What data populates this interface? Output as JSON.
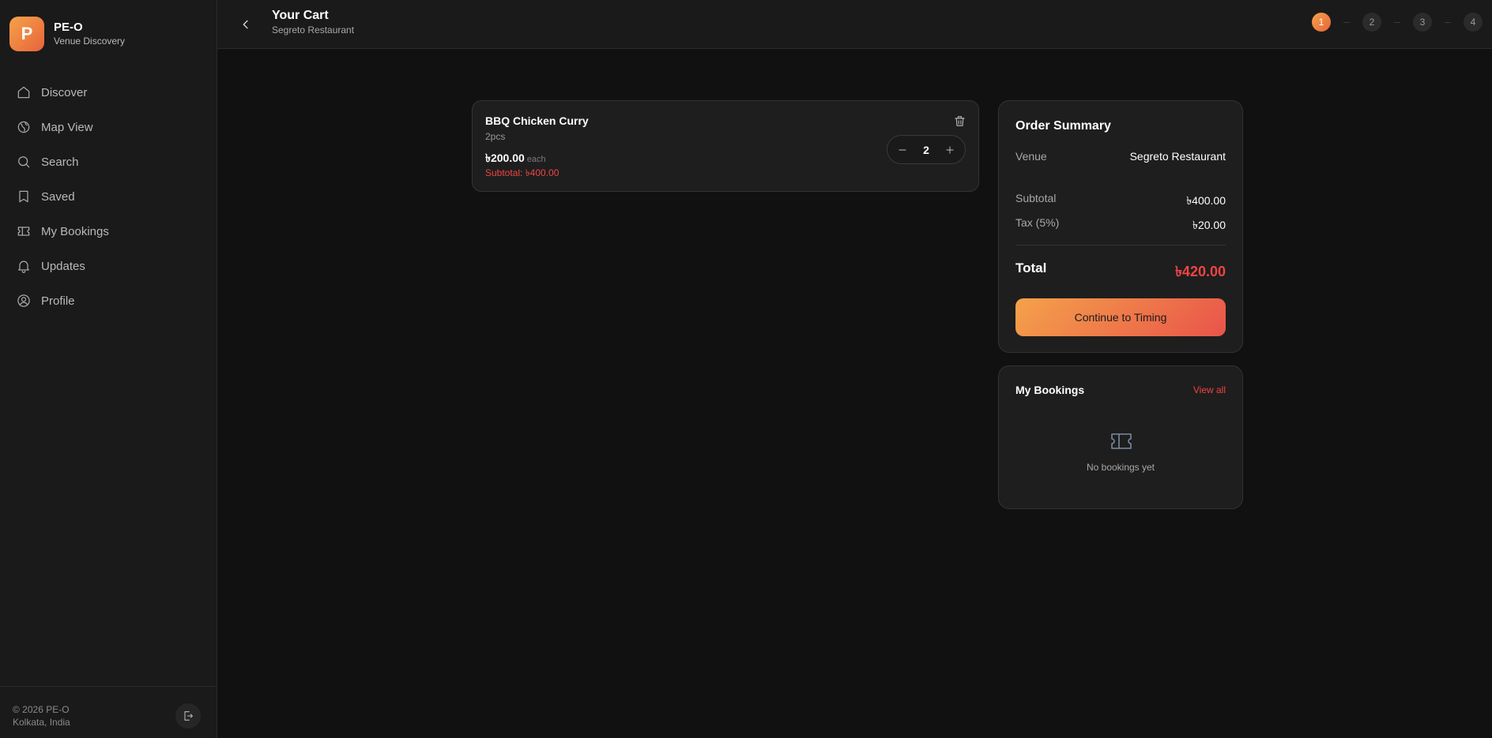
{
  "brand": {
    "logo_letter": "P",
    "name": "PE-O",
    "subtitle": "Venue Discovery",
    "accent": "#f07f3e"
  },
  "sidebar": {
    "items": [
      {
        "label": "Discover",
        "icon": "home-icon"
      },
      {
        "label": "Map View",
        "icon": "map-icon"
      },
      {
        "label": "Search",
        "icon": "search-icon"
      },
      {
        "label": "Saved",
        "icon": "bookmark-icon"
      },
      {
        "label": "My Bookings",
        "icon": "ticket-icon"
      },
      {
        "label": "Updates",
        "icon": "bell-icon"
      },
      {
        "label": "Profile",
        "icon": "user-icon"
      }
    ],
    "footer_line1": "© 2026 PE-O",
    "footer_line2": "Kolkata, India"
  },
  "header": {
    "title": "Your Cart",
    "subtitle": "Segreto Restaurant",
    "steps": [
      "1",
      "2",
      "3",
      "4"
    ],
    "active_step": 1
  },
  "cart": {
    "items": [
      {
        "name": "BBQ Chicken Curry",
        "variant": "2pcs",
        "price": "৳200.00",
        "each_label": "each",
        "subtotal": "Subtotal: ৳400.00",
        "quantity": "2"
      }
    ]
  },
  "summary": {
    "title": "Order Summary",
    "venue_label": "Venue",
    "venue_value": "Segreto Restaurant",
    "subtotal_label": "Subtotal",
    "subtotal_value": "৳400.00",
    "tax_label": "Tax (5%)",
    "tax_value": "৳20.00",
    "total_label": "Total",
    "total_value": "৳420.00",
    "continue_label": "Continue to Timing"
  },
  "bookings": {
    "title": "My Bookings",
    "view_all": "View all",
    "empty_text": "No bookings yet"
  },
  "colors": {
    "background": "#111111",
    "panel": "#1e1e1e",
    "danger": "#ef4444",
    "gradient_start": "#f5a24a",
    "gradient_end": "#e8544a"
  }
}
